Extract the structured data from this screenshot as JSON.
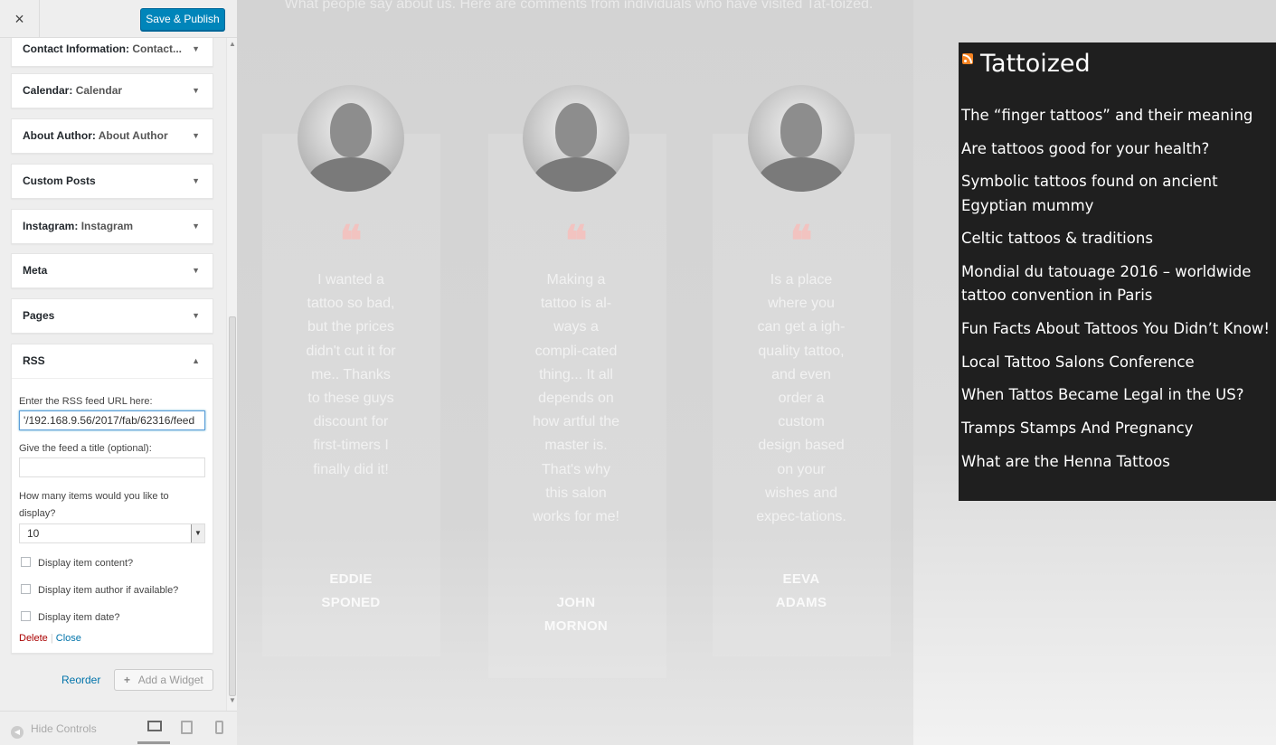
{
  "topbar": {
    "close_icon": "×",
    "save_label": "Save & Publish"
  },
  "widgets": [
    {
      "title": "Contact Information:",
      "subtitle": "Contact..."
    },
    {
      "title": "Calendar:",
      "subtitle": "Calendar"
    },
    {
      "title": "About Author:",
      "subtitle": "About Author"
    },
    {
      "title": "Custom Posts",
      "subtitle": ""
    },
    {
      "title": "Instagram:",
      "subtitle": "Instagram"
    },
    {
      "title": "Meta",
      "subtitle": ""
    },
    {
      "title": "Pages",
      "subtitle": ""
    }
  ],
  "rss_widget": {
    "title": "RSS",
    "url_label": "Enter the RSS feed URL here:",
    "url_value": "'/192.168.9.56/2017/fab/62316/feed",
    "title_label": "Give the feed a title (optional):",
    "title_value": "",
    "items_label": "How many items would you like to display?",
    "items_value": "10",
    "checkboxes": [
      {
        "label": "Display item content?",
        "checked": false
      },
      {
        "label": "Display item author if available?",
        "checked": false
      },
      {
        "label": "Display item date?",
        "checked": false
      }
    ],
    "delete_label": "Delete",
    "separator": "|",
    "close_label": "Close"
  },
  "footer_actions": {
    "reorder_label": "Reorder",
    "add_widget_label": "Add a Widget"
  },
  "bottom": {
    "hide_controls_label": "Hide Controls"
  },
  "preview": {
    "intro_text": "What people say about us. Here are comments from individuals who have visited Tat-toized.",
    "testimonials": [
      {
        "quote": "I wanted a tattoo so bad, but the prices didn't cut it for me.. Thanks to these guys discount for first-timers I finally did it!",
        "author": "EDDIE SPONED"
      },
      {
        "quote": "Making a tattoo is al-ways a compli-cated thing... It all depends on how artful the master is. That's why this salon works for me!",
        "author": "JOHN MORNON"
      },
      {
        "quote": "Is a place where you can get a igh-quality tattoo, and even order a custom design based on your wishes and expec-tations.",
        "author": "EEVA ADAMS"
      }
    ],
    "quote_mark": "❝",
    "rss_box": {
      "title": "Tattoized",
      "items": [
        "The “finger tattoos” and their meaning",
        "Are tattoos good for your health?",
        "Symbolic tattoos found on ancient Egyptian mummy",
        "Celtic tattoos & traditions",
        "Mondial du tatouage 2016 – worldwide tattoo convention in Paris",
        "Fun Facts About Tattoos You Didn’t Know!",
        "Local Tattoo Salons Conference",
        "When Tattos Became Legal in the US?",
        "Tramps Stamps And Pregnancy",
        "What are the Henna Tattoos"
      ]
    }
  },
  "colors": {
    "accent": "#0085ba",
    "rss_box_bg": "#1f1f1f",
    "quote_mark": "#f2c3c0",
    "delete": "#aa0000",
    "link": "#0073aa"
  }
}
